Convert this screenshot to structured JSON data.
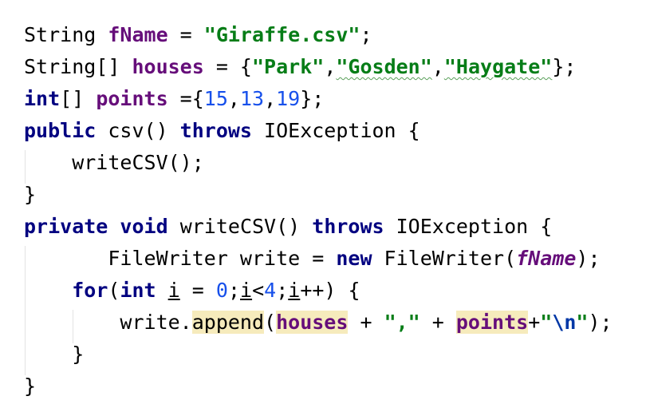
{
  "editor": {
    "lines": [
      {
        "tokens": [
          {
            "t": "String ",
            "c": "plain"
          },
          {
            "t": "fName",
            "c": "fld"
          },
          {
            "t": " = ",
            "c": "plain"
          },
          {
            "t": "\"Giraffe.csv\"",
            "c": "str"
          },
          {
            "t": ";",
            "c": "plain"
          }
        ]
      },
      {
        "tokens": [
          {
            "t": "String[] ",
            "c": "plain"
          },
          {
            "t": "houses",
            "c": "fld"
          },
          {
            "t": " = {",
            "c": "plain"
          },
          {
            "t": "\"Park\"",
            "c": "str"
          },
          {
            "t": ",",
            "c": "plain"
          },
          {
            "t": "\"Gosden\"",
            "c": "str typo"
          },
          {
            "t": ",",
            "c": "plain"
          },
          {
            "t": "\"Haygate\"",
            "c": "str typo"
          },
          {
            "t": "};",
            "c": "plain"
          }
        ]
      },
      {
        "tokens": [
          {
            "t": "int",
            "c": "kw"
          },
          {
            "t": "[] ",
            "c": "plain"
          },
          {
            "t": "points",
            "c": "fld"
          },
          {
            "t": " ={",
            "c": "plain"
          },
          {
            "t": "15",
            "c": "num"
          },
          {
            "t": ",",
            "c": "plain"
          },
          {
            "t": "13",
            "c": "num"
          },
          {
            "t": ",",
            "c": "plain"
          },
          {
            "t": "19",
            "c": "num"
          },
          {
            "t": "};",
            "c": "plain"
          }
        ]
      },
      {
        "tokens": [
          {
            "t": "public",
            "c": "kw"
          },
          {
            "t": " csv() ",
            "c": "plain"
          },
          {
            "t": "throws",
            "c": "kw"
          },
          {
            "t": " IOException {",
            "c": "plain"
          }
        ]
      },
      {
        "tokens": [
          {
            "t": "    writeCSV();",
            "c": "plain"
          }
        ]
      },
      {
        "tokens": [
          {
            "t": "}",
            "c": "plain"
          }
        ]
      },
      {
        "tokens": [
          {
            "t": "private",
            "c": "kw"
          },
          {
            "t": " ",
            "c": "plain"
          },
          {
            "t": "void",
            "c": "kw"
          },
          {
            "t": " writeCSV() ",
            "c": "plain"
          },
          {
            "t": "throws",
            "c": "kw"
          },
          {
            "t": " IOException {",
            "c": "plain"
          }
        ]
      },
      {
        "tokens": [
          {
            "t": "       FileWriter write = ",
            "c": "plain"
          },
          {
            "t": "new",
            "c": "kw"
          },
          {
            "t": " FileWriter(",
            "c": "plain"
          },
          {
            "t": "fName",
            "c": "fld-it"
          },
          {
            "t": ");",
            "c": "plain"
          }
        ]
      },
      {
        "tokens": [
          {
            "t": "    ",
            "c": "plain"
          },
          {
            "t": "for",
            "c": "kw"
          },
          {
            "t": "(",
            "c": "plain"
          },
          {
            "t": "int",
            "c": "kw"
          },
          {
            "t": " ",
            "c": "plain"
          },
          {
            "t": "i",
            "c": "uline"
          },
          {
            "t": " = ",
            "c": "plain"
          },
          {
            "t": "0",
            "c": "num"
          },
          {
            "t": ";",
            "c": "plain"
          },
          {
            "t": "i",
            "c": "uline"
          },
          {
            "t": "<",
            "c": "plain"
          },
          {
            "t": "4",
            "c": "num"
          },
          {
            "t": ";",
            "c": "plain"
          },
          {
            "t": "i",
            "c": "uline"
          },
          {
            "t": "++) {",
            "c": "plain"
          }
        ]
      },
      {
        "tokens": [
          {
            "t": "        write.",
            "c": "plain"
          },
          {
            "t": "append",
            "c": "hl"
          },
          {
            "t": "(",
            "c": "plain"
          },
          {
            "t": "houses",
            "c": "fld hl"
          },
          {
            "t": " + ",
            "c": "plain"
          },
          {
            "t": "\",\"",
            "c": "str"
          },
          {
            "t": " + ",
            "c": "plain"
          },
          {
            "t": "points",
            "c": "fld hl"
          },
          {
            "t": "+",
            "c": "plain"
          },
          {
            "t": "\"",
            "c": "str"
          },
          {
            "t": "\\n",
            "c": "esc"
          },
          {
            "t": "\"",
            "c": "str"
          },
          {
            "t": ");",
            "c": "plain"
          }
        ]
      },
      {
        "tokens": [
          {
            "t": "    }",
            "c": "plain"
          }
        ]
      },
      {
        "tokens": [
          {
            "t": "}",
            "c": "plain"
          }
        ]
      }
    ]
  }
}
